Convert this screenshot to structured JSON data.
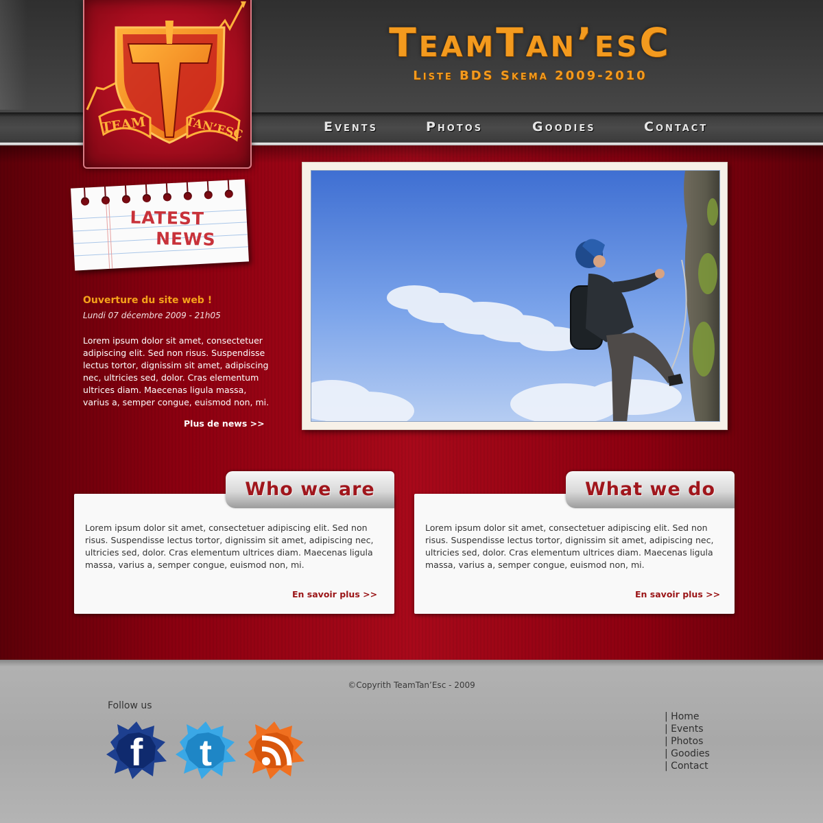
{
  "header": {
    "title": "TeamTan’esC",
    "subtitle": "Liste BDS Skema 2009-2010",
    "logo_text_left": "TEAM",
    "logo_text_right": "TAN’ESC"
  },
  "nav": {
    "items": [
      {
        "label": "Events"
      },
      {
        "label": "Photos"
      },
      {
        "label": "Goodies"
      },
      {
        "label": "Contact"
      }
    ]
  },
  "news": {
    "badge_line1": "LATEST",
    "badge_line2": "NEWS",
    "title": "Ouverture du site web !",
    "date": "Lundi 07 décembre 2009 - 21h05",
    "body": "Lorem ipsum dolor sit amet, consectetuer adipiscing elit. Sed non risus. Suspendisse lectus tortor, dignissim sit amet, adipiscing nec, ultricies sed, dolor. Cras elementum ultrices diam. Maecenas ligula massa, varius a, semper congue, euismod non, mi.",
    "more_label": "Plus de news >>"
  },
  "sections": [
    {
      "tab_label": "Who we are",
      "body": "Lorem ipsum dolor sit amet, consectetuer adipiscing elit. Sed non risus. Suspendisse lectus tortor, dignissim sit amet, adipiscing nec, ultricies sed, dolor. Cras elementum ultrices diam. Maecenas ligula massa, varius a, semper congue, euismod non, mi.",
      "more_label": "En savoir plus >>"
    },
    {
      "tab_label": "What we do",
      "body": "Lorem ipsum dolor sit amet, consectetuer adipiscing elit. Sed non risus. Suspendisse lectus tortor, dignissim sit amet, adipiscing nec, ultricies sed, dolor. Cras elementum ultrices diam. Maecenas ligula massa, varius a, semper congue, euismod non, mi.",
      "more_label": "En savoir plus >>"
    }
  ],
  "footer": {
    "copyright": "©Copyrith TeamTan’Esc - 2009",
    "follow_label": "Follow us",
    "social": [
      {
        "icon": "facebook-icon"
      },
      {
        "icon": "twitter-icon"
      },
      {
        "icon": "rss-icon"
      }
    ],
    "links": [
      {
        "label": "| Home"
      },
      {
        "label": "| Events"
      },
      {
        "label": "| Photos"
      },
      {
        "label": "| Goodies"
      },
      {
        "label": "| Contact"
      }
    ]
  },
  "colors": {
    "accent_orange": "#f39a1e",
    "brand_red": "#a8091a",
    "tab_title_red": "#a0161c",
    "link_red": "#9a1416"
  }
}
